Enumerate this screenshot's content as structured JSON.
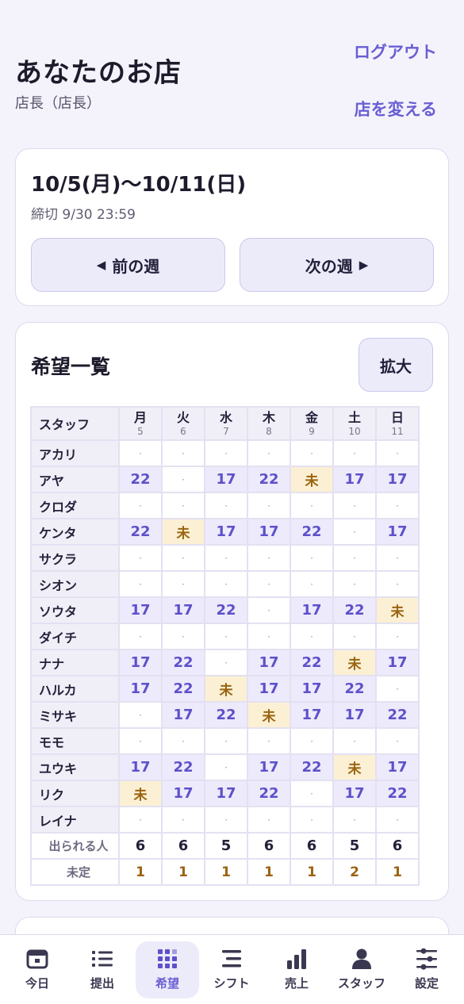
{
  "header": {
    "shop_name": "あなたのお店",
    "role": "店長（店長）",
    "logout": "ログアウト",
    "change_shop": "店を変える"
  },
  "week": {
    "title": "10/5(月)〜10/11(日)",
    "deadline": "締切 9/30 23:59",
    "prev_label": "前の週",
    "next_label": "次の週"
  },
  "requests": {
    "title": "希望一覧",
    "zoom_label": "拡大",
    "staff_header": "スタッフ",
    "days": [
      {
        "name": "月",
        "num": "5"
      },
      {
        "name": "火",
        "num": "6"
      },
      {
        "name": "水",
        "num": "7"
      },
      {
        "name": "木",
        "num": "8"
      },
      {
        "name": "金",
        "num": "9"
      },
      {
        "name": "土",
        "num": "10"
      },
      {
        "name": "日",
        "num": "11"
      }
    ],
    "rows": [
      {
        "name": "アカリ",
        "cells": [
          "·",
          "·",
          "·",
          "·",
          "·",
          "·",
          "·"
        ]
      },
      {
        "name": "アヤ",
        "cells": [
          "22",
          "·",
          "17",
          "22",
          "未",
          "17",
          "17"
        ]
      },
      {
        "name": "クロダ",
        "cells": [
          "·",
          "·",
          "·",
          "·",
          "·",
          "·",
          "·"
        ]
      },
      {
        "name": "ケンタ",
        "cells": [
          "22",
          "未",
          "17",
          "17",
          "22",
          "·",
          "17"
        ]
      },
      {
        "name": "サクラ",
        "cells": [
          "·",
          "·",
          "·",
          "·",
          "·",
          "·",
          "·"
        ]
      },
      {
        "name": "シオン",
        "cells": [
          "·",
          "·",
          "·",
          "·",
          "·",
          "·",
          "·"
        ]
      },
      {
        "name": "ソウタ",
        "cells": [
          "17",
          "17",
          "22",
          "·",
          "17",
          "22",
          "未"
        ]
      },
      {
        "name": "ダイチ",
        "cells": [
          "·",
          "·",
          "·",
          "·",
          "·",
          "·",
          "·"
        ]
      },
      {
        "name": "ナナ",
        "cells": [
          "17",
          "22",
          "·",
          "17",
          "22",
          "未",
          "17"
        ]
      },
      {
        "name": "ハルカ",
        "cells": [
          "17",
          "22",
          "未",
          "17",
          "17",
          "22",
          "·"
        ]
      },
      {
        "name": "ミサキ",
        "cells": [
          "·",
          "17",
          "22",
          "未",
          "17",
          "17",
          "22"
        ]
      },
      {
        "name": "モモ",
        "cells": [
          "·",
          "·",
          "·",
          "·",
          "·",
          "·",
          "·"
        ]
      },
      {
        "name": "ユウキ",
        "cells": [
          "17",
          "22",
          "·",
          "17",
          "22",
          "未",
          "17"
        ]
      },
      {
        "name": "リク",
        "cells": [
          "未",
          "17",
          "17",
          "22",
          "·",
          "17",
          "22"
        ]
      },
      {
        "name": "レイナ",
        "cells": [
          "·",
          "·",
          "·",
          "·",
          "·",
          "·",
          "·"
        ]
      }
    ],
    "available_label": "出られる人",
    "available": [
      "6",
      "6",
      "5",
      "6",
      "6",
      "5",
      "6"
    ],
    "pending_label": "未定",
    "pending": [
      "1",
      "1",
      "1",
      "1",
      "1",
      "2",
      "1"
    ]
  },
  "tabs": [
    {
      "label": "今日",
      "icon": "calendar-icon"
    },
    {
      "label": "提出",
      "icon": "list-icon"
    },
    {
      "label": "希望",
      "icon": "grid-icon"
    },
    {
      "label": "シフト",
      "icon": "shift-lines-icon"
    },
    {
      "label": "売上",
      "icon": "bar-chart-icon"
    },
    {
      "label": "スタッフ",
      "icon": "person-icon"
    },
    {
      "label": "設定",
      "icon": "sliders-icon"
    }
  ],
  "active_tab": "希望",
  "colors": {
    "accent": "#6a5ed4",
    "request_cell": "#eceafb",
    "pending_cell": "#fcf0d4",
    "pending_text": "#9a6410"
  }
}
